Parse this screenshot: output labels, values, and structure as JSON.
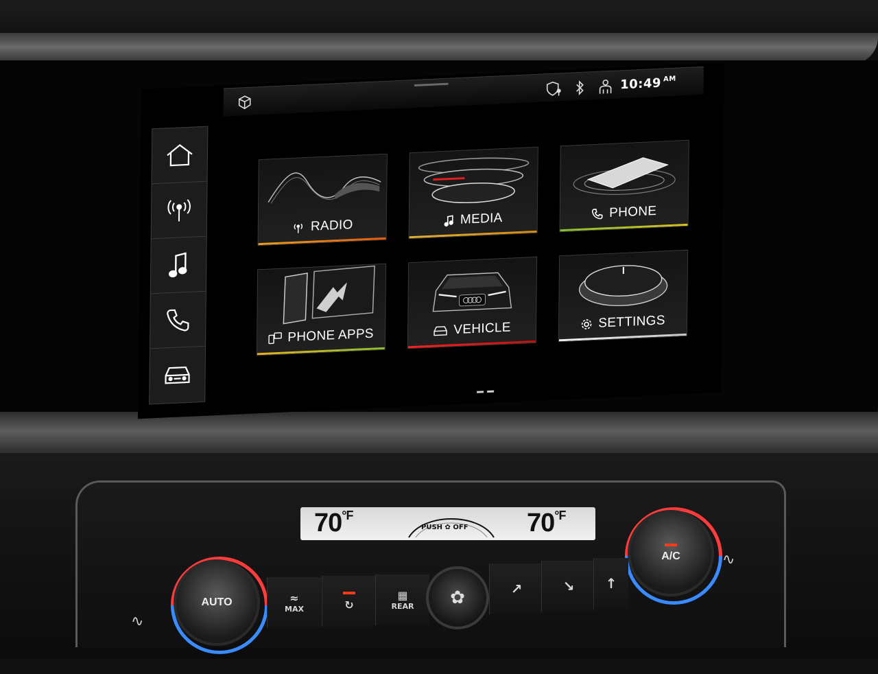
{
  "status_bar": {
    "time": "10:49",
    "ampm": "AM",
    "icons": [
      "cube-icon",
      "privacy-shield-icon",
      "bluetooth-icon",
      "user-profile-icon"
    ]
  },
  "side_nav": {
    "items": [
      {
        "name": "home",
        "icon": "home-icon"
      },
      {
        "name": "radio",
        "icon": "antenna-icon"
      },
      {
        "name": "music",
        "icon": "music-note-icon"
      },
      {
        "name": "phone",
        "icon": "phone-icon"
      },
      {
        "name": "vehicle",
        "icon": "car-icon"
      }
    ]
  },
  "tiles": [
    {
      "label": "RADIO",
      "icon": "antenna-icon",
      "accent": [
        "#e8a020",
        "#e45a10"
      ]
    },
    {
      "label": "MEDIA",
      "icon": "music-note-icon",
      "accent": [
        "#e0b030",
        "#d88a10"
      ]
    },
    {
      "label": "PHONE",
      "icon": "phone-icon",
      "accent": [
        "#8ac030",
        "#d8c020"
      ]
    },
    {
      "label": "PHONE APPS",
      "icon": "phone-apps-icon",
      "accent": [
        "#e8b020",
        "#8ac030"
      ]
    },
    {
      "label": "VEHICLE",
      "icon": "car-icon",
      "accent": [
        "#ff2020",
        "#c01010"
      ]
    },
    {
      "label": "SETTINGS",
      "icon": "gear-icon",
      "accent": [
        "#f0f0f0",
        "#c8c8c8"
      ]
    }
  ],
  "climate": {
    "left_temp": "70",
    "right_temp": "70",
    "unit": "°F",
    "fan_text_push": "PUSH",
    "fan_text_off": "OFF",
    "left_knob_label": "AUTO",
    "right_knob_label": "A/C",
    "max_label": "MAX",
    "rear_label": "REAR"
  }
}
